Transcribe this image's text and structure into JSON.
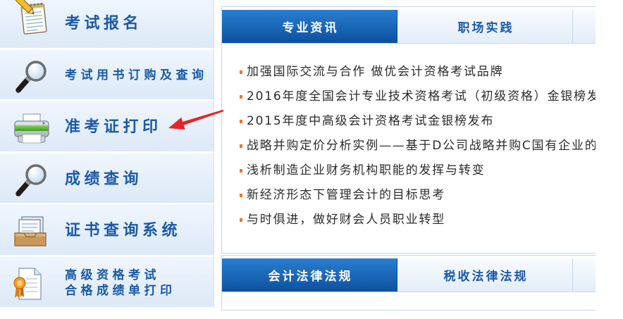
{
  "sidebar": {
    "items": [
      {
        "label": "考试报名",
        "icon": "notepad-pencil-icon"
      },
      {
        "label": "考试用书订购及查询",
        "icon": "magnifier-icon"
      },
      {
        "label": "准考证打印",
        "icon": "printer-icon"
      },
      {
        "label": "成绩查询",
        "icon": "magnifier-icon"
      },
      {
        "label": "证书查询系统",
        "icon": "certificate-stack-icon"
      },
      {
        "label_lines": [
          "高级资格考试",
          "合格成绩单打印"
        ],
        "icon": "certificate-ribbon-icon"
      }
    ]
  },
  "news_panel": {
    "tabs": [
      {
        "label": "专业资讯",
        "active": true
      },
      {
        "label": "职场实践",
        "active": false
      }
    ],
    "items": [
      "加强国际交流与合作 做优会计资格考试品牌",
      "2016年度全国会计专业技术资格考试（初级资格）金银榜发",
      "2015年度中高级会计资格考试金银榜发布",
      "战略并购定价分析实例——基于D公司战略并购C国有企业的",
      "浅析制造企业财务机构职能的发挥与转变",
      "新经济形态下管理会计的目标思考",
      "与时俱进，做好财会人员职业转型"
    ]
  },
  "law_panel": {
    "tabs": [
      {
        "label": "会计法律法规",
        "active": true
      },
      {
        "label": "税收法律法规",
        "active": false
      }
    ]
  },
  "annotation": {
    "shape": "arrow-icon"
  },
  "colors": {
    "sidebar_text": "#1a5aa8",
    "sidebar_bg_top": "#f0f6fe",
    "sidebar_bg_bottom": "#dde9f7",
    "tab_active_top": "#2a7ed1",
    "tab_active_bottom": "#0c519f",
    "tab_text": "#1a5aa8",
    "bullet": "#e9762b",
    "list_text": "#2b2b2b",
    "border": "#c7d7eb",
    "arrow": "#e4262b"
  }
}
